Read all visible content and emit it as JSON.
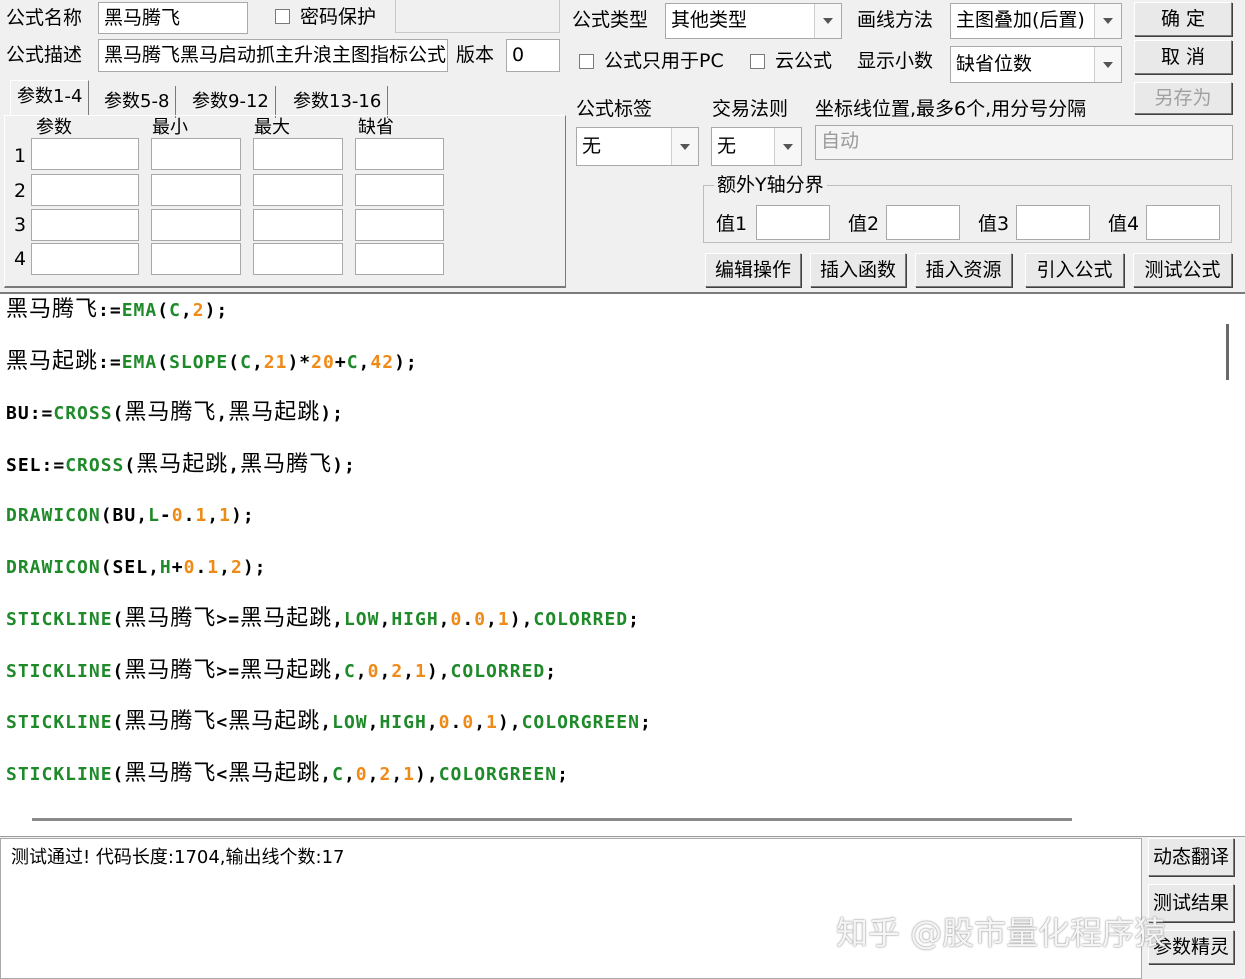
{
  "header": {
    "name_label": "公式名称",
    "name_value": "黑马腾飞",
    "password_label": "密码保护",
    "desc_label": "公式描述",
    "desc_value": "黑马腾飞黑马启动抓主升浪主图指标公式",
    "version_label": "版本",
    "version_value": "0",
    "type_label": "公式类型",
    "type_value": "其他类型",
    "draw_label": "画线方法",
    "draw_value": "主图叠加(后置)",
    "pc_only_label": "公式只用于PC",
    "cloud_label": "云公式",
    "decimals_label": "显示小数",
    "decimals_value": "缺省位数",
    "tag_label": "公式标签",
    "tag_value": "无",
    "rule_label": "交易法则",
    "rule_value": "无",
    "axis_label": "坐标线位置,最多6个,用分号分隔",
    "axis_placeholder": "自动"
  },
  "buttons": {
    "ok": "确  定",
    "cancel": "取  消",
    "save_as": "另存为",
    "edit_ops": "编辑操作",
    "insert_func": "插入函数",
    "insert_res": "插入资源",
    "import_formula": "引入公式",
    "test_formula": "测试公式",
    "dyn_translate": "动态翻译",
    "test_result": "测试结果",
    "param_wizard": "参数精灵"
  },
  "params": {
    "tabs": [
      "参数1-4",
      "参数5-8",
      "参数9-12",
      "参数13-16"
    ],
    "headers": [
      "参数",
      "最小",
      "最大",
      "缺省"
    ],
    "rows": [
      "1",
      "2",
      "3",
      "4"
    ]
  },
  "yaxis": {
    "title": "额外Y轴分界",
    "labels": [
      "值1",
      "值2",
      "值3",
      "值4"
    ]
  },
  "code": [
    [
      {
        "t": "黑马腾飞",
        "c": "cn"
      },
      {
        "t": ":=",
        "c": "op"
      },
      {
        "t": "EMA",
        "c": "fn"
      },
      {
        "t": "(",
        "c": "op"
      },
      {
        "t": "C",
        "c": "fn"
      },
      {
        "t": ",",
        "c": "op"
      },
      {
        "t": "2",
        "c": "num"
      },
      {
        "t": ");",
        "c": "op"
      }
    ],
    [
      {
        "t": "黑马起跳",
        "c": "cn"
      },
      {
        "t": ":=",
        "c": "op"
      },
      {
        "t": "EMA",
        "c": "fn"
      },
      {
        "t": "(",
        "c": "op"
      },
      {
        "t": "SLOPE",
        "c": "fn"
      },
      {
        "t": "(",
        "c": "op"
      },
      {
        "t": "C",
        "c": "fn"
      },
      {
        "t": ",",
        "c": "op"
      },
      {
        "t": "21",
        "c": "num"
      },
      {
        "t": ")*",
        "c": "op"
      },
      {
        "t": "20",
        "c": "num"
      },
      {
        "t": "+",
        "c": "op"
      },
      {
        "t": "C",
        "c": "fn"
      },
      {
        "t": ",",
        "c": "op"
      },
      {
        "t": "42",
        "c": "num"
      },
      {
        "t": ");",
        "c": "op"
      }
    ],
    [
      {
        "t": "BU",
        "c": "var"
      },
      {
        "t": ":=",
        "c": "op"
      },
      {
        "t": "CROSS",
        "c": "fn"
      },
      {
        "t": "(",
        "c": "op"
      },
      {
        "t": "黑马腾飞",
        "c": "cn"
      },
      {
        "t": ",",
        "c": "op"
      },
      {
        "t": "黑马起跳",
        "c": "cn"
      },
      {
        "t": ");",
        "c": "op"
      }
    ],
    [
      {
        "t": "SEL",
        "c": "var"
      },
      {
        "t": ":=",
        "c": "op"
      },
      {
        "t": "CROSS",
        "c": "fn"
      },
      {
        "t": "(",
        "c": "op"
      },
      {
        "t": "黑马起跳",
        "c": "cn"
      },
      {
        "t": ",",
        "c": "op"
      },
      {
        "t": "黑马腾飞",
        "c": "cn"
      },
      {
        "t": ");",
        "c": "op"
      }
    ],
    [
      {
        "t": "DRAWICON",
        "c": "fn"
      },
      {
        "t": "(",
        "c": "op"
      },
      {
        "t": "BU",
        "c": "var"
      },
      {
        "t": ",",
        "c": "op"
      },
      {
        "t": "L",
        "c": "fn"
      },
      {
        "t": "-",
        "c": "op"
      },
      {
        "t": "0",
        "c": "num"
      },
      {
        "t": ".",
        "c": "op"
      },
      {
        "t": "1",
        "c": "num"
      },
      {
        "t": ",",
        "c": "op"
      },
      {
        "t": "1",
        "c": "num"
      },
      {
        "t": ");",
        "c": "op"
      }
    ],
    [
      {
        "t": "DRAWICON",
        "c": "fn"
      },
      {
        "t": "(",
        "c": "op"
      },
      {
        "t": "SEL",
        "c": "var"
      },
      {
        "t": ",",
        "c": "op"
      },
      {
        "t": "H",
        "c": "fn"
      },
      {
        "t": "+",
        "c": "op"
      },
      {
        "t": "0",
        "c": "num"
      },
      {
        "t": ".",
        "c": "op"
      },
      {
        "t": "1",
        "c": "num"
      },
      {
        "t": ",",
        "c": "op"
      },
      {
        "t": "2",
        "c": "num"
      },
      {
        "t": ");",
        "c": "op"
      }
    ],
    [
      {
        "t": "STICKLINE",
        "c": "fn"
      },
      {
        "t": "(",
        "c": "op"
      },
      {
        "t": "黑马腾飞",
        "c": "cn"
      },
      {
        "t": ">=",
        "c": "op"
      },
      {
        "t": "黑马起跳",
        "c": "cn"
      },
      {
        "t": ",",
        "c": "op"
      },
      {
        "t": "LOW",
        "c": "fn"
      },
      {
        "t": ",",
        "c": "op"
      },
      {
        "t": "HIGH",
        "c": "fn"
      },
      {
        "t": ",",
        "c": "op"
      },
      {
        "t": "0",
        "c": "num"
      },
      {
        "t": ".",
        "c": "op"
      },
      {
        "t": "0",
        "c": "num"
      },
      {
        "t": ",",
        "c": "op"
      },
      {
        "t": "1",
        "c": "num"
      },
      {
        "t": "),",
        "c": "op"
      },
      {
        "t": "COLORRED",
        "c": "fn"
      },
      {
        "t": ";",
        "c": "op"
      }
    ],
    [
      {
        "t": "STICKLINE",
        "c": "fn"
      },
      {
        "t": "(",
        "c": "op"
      },
      {
        "t": "黑马腾飞",
        "c": "cn"
      },
      {
        "t": ">=",
        "c": "op"
      },
      {
        "t": "黑马起跳",
        "c": "cn"
      },
      {
        "t": ",",
        "c": "op"
      },
      {
        "t": "C",
        "c": "fn"
      },
      {
        "t": ",",
        "c": "op"
      },
      {
        "t": "0",
        "c": "num"
      },
      {
        "t": ",",
        "c": "op"
      },
      {
        "t": "2",
        "c": "num"
      },
      {
        "t": ",",
        "c": "op"
      },
      {
        "t": "1",
        "c": "num"
      },
      {
        "t": "),",
        "c": "op"
      },
      {
        "t": "COLORRED",
        "c": "fn"
      },
      {
        "t": ";",
        "c": "op"
      }
    ],
    [
      {
        "t": "STICKLINE",
        "c": "fn"
      },
      {
        "t": "(",
        "c": "op"
      },
      {
        "t": "黑马腾飞",
        "c": "cn"
      },
      {
        "t": "<",
        "c": "op"
      },
      {
        "t": "黑马起跳",
        "c": "cn"
      },
      {
        "t": ",",
        "c": "op"
      },
      {
        "t": "LOW",
        "c": "fn"
      },
      {
        "t": ",",
        "c": "op"
      },
      {
        "t": "HIGH",
        "c": "fn"
      },
      {
        "t": ",",
        "c": "op"
      },
      {
        "t": "0",
        "c": "num"
      },
      {
        "t": ".",
        "c": "op"
      },
      {
        "t": "0",
        "c": "num"
      },
      {
        "t": ",",
        "c": "op"
      },
      {
        "t": "1",
        "c": "num"
      },
      {
        "t": "),",
        "c": "op"
      },
      {
        "t": "COLORGREEN",
        "c": "fn"
      },
      {
        "t": ";",
        "c": "op"
      }
    ],
    [
      {
        "t": "STICKLINE",
        "c": "fn"
      },
      {
        "t": "(",
        "c": "op"
      },
      {
        "t": "黑马腾飞",
        "c": "cn"
      },
      {
        "t": "<",
        "c": "op"
      },
      {
        "t": "黑马起跳",
        "c": "cn"
      },
      {
        "t": ",",
        "c": "op"
      },
      {
        "t": "C",
        "c": "fn"
      },
      {
        "t": ",",
        "c": "op"
      },
      {
        "t": "0",
        "c": "num"
      },
      {
        "t": ",",
        "c": "op"
      },
      {
        "t": "2",
        "c": "num"
      },
      {
        "t": ",",
        "c": "op"
      },
      {
        "t": "1",
        "c": "num"
      },
      {
        "t": "),",
        "c": "op"
      },
      {
        "t": "COLORGREEN",
        "c": "fn"
      },
      {
        "t": ";",
        "c": "op"
      }
    ]
  ],
  "output_text": "测试通过! 代码长度:1704,输出线个数:17",
  "watermark": "知乎 @股市量化程序猿",
  "colors": {
    "function_green": "#1f8a2a",
    "number_orange": "#f08a17",
    "window_bg": "#f0f0f0"
  }
}
